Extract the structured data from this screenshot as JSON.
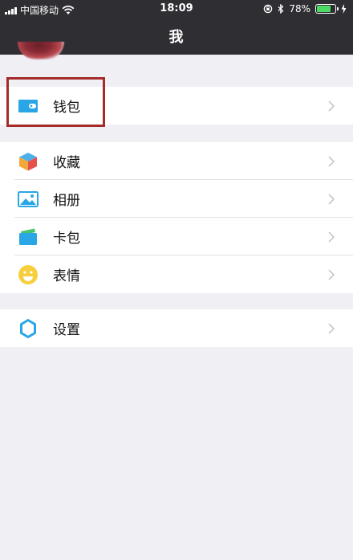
{
  "status_bar": {
    "carrier": "中国移动",
    "time": "18:09",
    "battery_percent": "78%",
    "battery_level": 0.78,
    "battery_color": "#4cd964"
  },
  "header": {
    "title": "我"
  },
  "groups": [
    {
      "items": [
        {
          "label": "钱包",
          "icon": "wallet-icon",
          "highlighted": true
        }
      ]
    },
    {
      "items": [
        {
          "label": "收藏",
          "icon": "cube-icon"
        },
        {
          "label": "相册",
          "icon": "photo-album-icon"
        },
        {
          "label": "卡包",
          "icon": "card-pack-icon"
        },
        {
          "label": "表情",
          "icon": "smiley-icon"
        }
      ]
    },
    {
      "items": [
        {
          "label": "设置",
          "icon": "gear-icon"
        }
      ]
    }
  ],
  "colors": {
    "nav_background": "#2e2e33",
    "page_background": "#efeff4",
    "highlight_border": "#a52a2a"
  }
}
